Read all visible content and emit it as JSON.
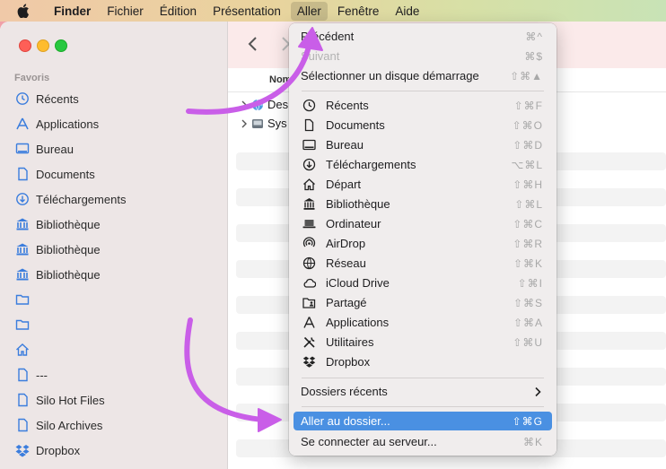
{
  "menubar": {
    "apple_icon": "apple-logo-icon",
    "items": [
      {
        "label": "Finder",
        "bold": true
      },
      {
        "label": "Fichier"
      },
      {
        "label": "Édition"
      },
      {
        "label": "Présentation"
      },
      {
        "label": "Aller",
        "active": true
      },
      {
        "label": "Fenêtre"
      },
      {
        "label": "Aide"
      }
    ]
  },
  "sidebar": {
    "heading": "Favoris",
    "items": [
      {
        "label": "Récents",
        "icon": "clock-icon"
      },
      {
        "label": "Applications",
        "icon": "applications-icon"
      },
      {
        "label": "Bureau",
        "icon": "desktop-icon"
      },
      {
        "label": "Documents",
        "icon": "document-icon"
      },
      {
        "label": "Téléchargements",
        "icon": "download-icon"
      },
      {
        "label": "Bibliothèque",
        "icon": "library-icon"
      },
      {
        "label": "Bibliothèque",
        "icon": "library-icon"
      },
      {
        "label": "Bibliothèque",
        "icon": "library-icon"
      },
      {
        "label": "",
        "icon": "folder-icon"
      },
      {
        "label": "",
        "icon": "folder-icon"
      },
      {
        "label": "",
        "icon": "home-icon"
      },
      {
        "label": "---",
        "icon": "document-icon"
      },
      {
        "label": "Silo Hot Files",
        "icon": "document-icon"
      },
      {
        "label": "Silo Archives",
        "icon": "document-icon"
      },
      {
        "label": "Dropbox",
        "icon": "dropbox-icon"
      }
    ]
  },
  "content": {
    "column_name": "Nom",
    "rows": [
      {
        "label": "Des",
        "icon": "network-globe-icon"
      },
      {
        "label": "Sys",
        "icon": "disk-icon"
      }
    ]
  },
  "go_menu": {
    "top_items": [
      {
        "label": "Précédent",
        "shortcut": "⌘^",
        "enabled": true
      },
      {
        "label": "Suivant",
        "shortcut": "⌘$",
        "enabled": false
      },
      {
        "label": "Sélectionner un disque démarrage",
        "shortcut": "⇧⌘▲",
        "enabled": true
      }
    ],
    "places": [
      {
        "label": "Récents",
        "shortcut": "⇧⌘F",
        "icon": "clock-icon"
      },
      {
        "label": "Documents",
        "shortcut": "⇧⌘O",
        "icon": "document-icon"
      },
      {
        "label": "Bureau",
        "shortcut": "⇧⌘D",
        "icon": "desktop-icon"
      },
      {
        "label": "Téléchargements",
        "shortcut": "⌥⌘L",
        "icon": "download-icon"
      },
      {
        "label": "Départ",
        "shortcut": "⇧⌘H",
        "icon": "home-icon"
      },
      {
        "label": "Bibliothèque",
        "shortcut": "⇧⌘L",
        "icon": "library-icon"
      },
      {
        "label": "Ordinateur",
        "shortcut": "⇧⌘C",
        "icon": "laptop-icon"
      },
      {
        "label": "AirDrop",
        "shortcut": "⇧⌘R",
        "icon": "airdrop-icon"
      },
      {
        "label": "Réseau",
        "shortcut": "⇧⌘K",
        "icon": "globe-icon"
      },
      {
        "label": "iCloud Drive",
        "shortcut": "⇧⌘I",
        "icon": "cloud-icon"
      },
      {
        "label": "Partagé",
        "shortcut": "⇧⌘S",
        "icon": "shared-folder-icon"
      },
      {
        "label": "Applications",
        "shortcut": "⇧⌘A",
        "icon": "applications-icon"
      },
      {
        "label": "Utilitaires",
        "shortcut": "⇧⌘U",
        "icon": "tools-icon"
      },
      {
        "label": "Dropbox",
        "shortcut": "",
        "icon": "dropbox-icon"
      }
    ],
    "recent_folders": {
      "label": "Dossiers récents"
    },
    "bottom_items": [
      {
        "label": "Aller au dossier...",
        "shortcut": "⇧⌘G",
        "highlighted": true
      },
      {
        "label": "Se connecter au serveur...",
        "shortcut": "⌘K",
        "highlighted": false
      }
    ]
  },
  "colors": {
    "highlight": "#4a90e2",
    "annotation_arrow": "#c95ee8"
  }
}
